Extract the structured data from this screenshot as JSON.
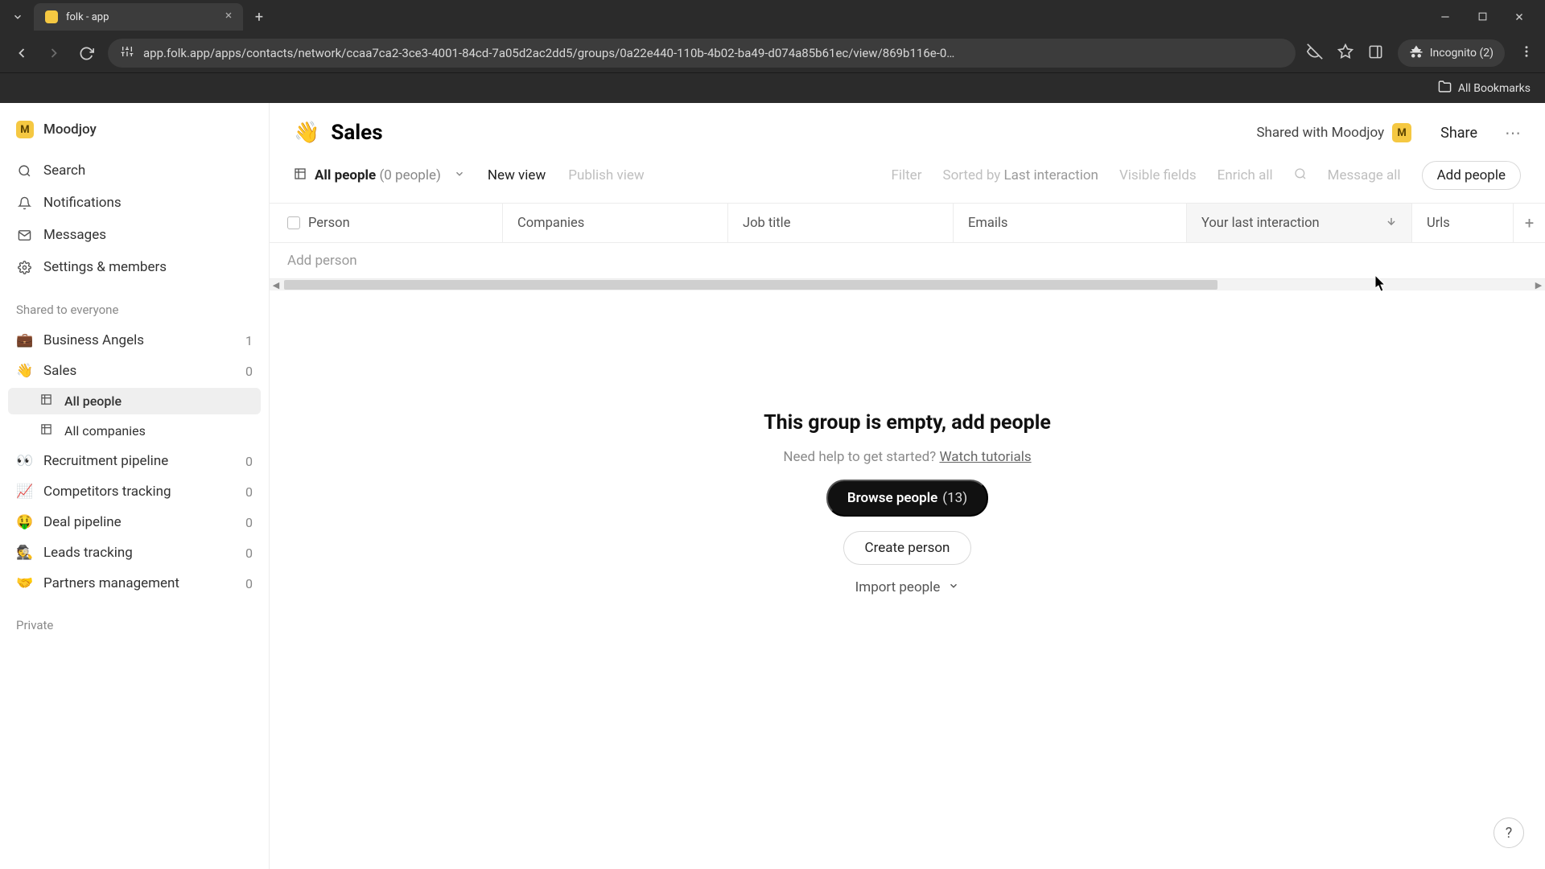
{
  "browser": {
    "tab_title": "folk - app",
    "url": "app.folk.app/apps/contacts/network/ccaa7ca2-3ce3-4001-84cd-7a05d2ac2dd5/groups/0a22e440-110b-4b02-ba49-d074a85b61ec/view/869b116e-0…",
    "incognito_label": "Incognito (2)",
    "bookmarks_label": "All Bookmarks"
  },
  "sidebar": {
    "workspace": "Moodjoy",
    "nav": {
      "search": "Search",
      "notifications": "Notifications",
      "messages": "Messages",
      "settings": "Settings & members"
    },
    "shared_label": "Shared to everyone",
    "groups": [
      {
        "emoji": "💼",
        "label": "Business Angels",
        "count": "1"
      },
      {
        "emoji": "👋",
        "label": "Sales",
        "count": "0"
      },
      {
        "emoji": "👀",
        "label": "Recruitment pipeline",
        "count": "0"
      },
      {
        "emoji": "📈",
        "label": "Competitors tracking",
        "count": "0"
      },
      {
        "emoji": "🤑",
        "label": "Deal pipeline",
        "count": "0"
      },
      {
        "emoji": "🕵️",
        "label": "Leads tracking",
        "count": "0"
      },
      {
        "emoji": "🤝",
        "label": "Partners management",
        "count": "0"
      }
    ],
    "subviews": {
      "all_people": "All people",
      "all_companies": "All companies"
    },
    "private_label": "Private"
  },
  "header": {
    "emoji": "👋",
    "title": "Sales",
    "shared_with": "Shared with Moodjoy",
    "badge": "M",
    "share": "Share"
  },
  "toolbar": {
    "view_name": "All people",
    "view_count": "(0 people)",
    "new_view": "New view",
    "publish": "Publish view",
    "filter": "Filter",
    "sorted_prefix": "Sorted by ",
    "sorted_field": "Last interaction",
    "visible_fields": "Visible fields",
    "enrich": "Enrich all",
    "message_all": "Message all",
    "add_people": "Add people"
  },
  "columns": {
    "person": "Person",
    "companies": "Companies",
    "job": "Job title",
    "emails": "Emails",
    "last_interaction": "Your last interaction",
    "urls": "Urls"
  },
  "table": {
    "add_person_placeholder": "Add person"
  },
  "empty": {
    "title": "This group is empty, add people",
    "help_prefix": "Need help to get started? ",
    "help_link": "Watch tutorials",
    "browse_label": "Browse people",
    "browse_count": "(13)",
    "create": "Create person",
    "import": "Import people"
  }
}
